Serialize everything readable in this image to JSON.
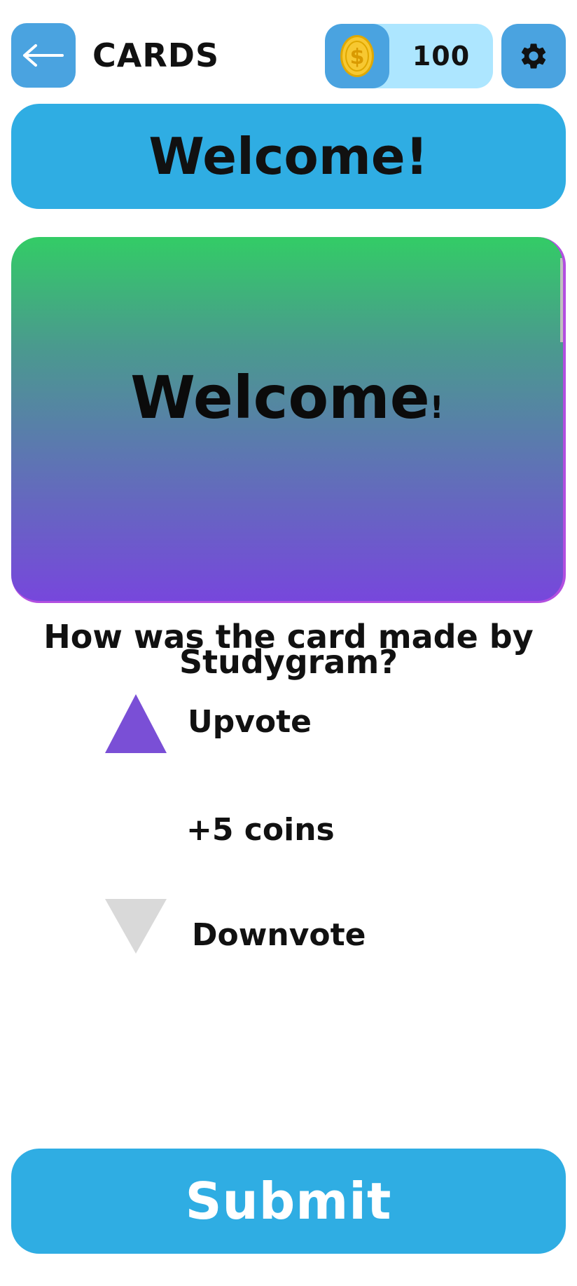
{
  "header": {
    "title": "CARDS",
    "coins": "100",
    "back_icon": "arrow-left-icon",
    "coin_icon": "coin-icon",
    "settings_icon": "gear-icon"
  },
  "banner": {
    "text": "Welcome!"
  },
  "card": {
    "text_main": "Welcome",
    "text_end": "!",
    "gradient_top": "#33cc66",
    "gradient_bottom": "#7747dc"
  },
  "rating": {
    "question_line1": "How was the card made by",
    "question_line2": "Studygram?",
    "upvote_label": "Upvote",
    "downvote_label": "Downvote",
    "reward": "+5 coins",
    "upvote_color": "#7a4fd6",
    "downvote_color": "#d9d9d9"
  },
  "submit": {
    "label": "Submit"
  },
  "colors": {
    "primary_button": "#2fade3",
    "icon_button": "#4aa3e0",
    "coin_pill": "#ade6ff"
  }
}
